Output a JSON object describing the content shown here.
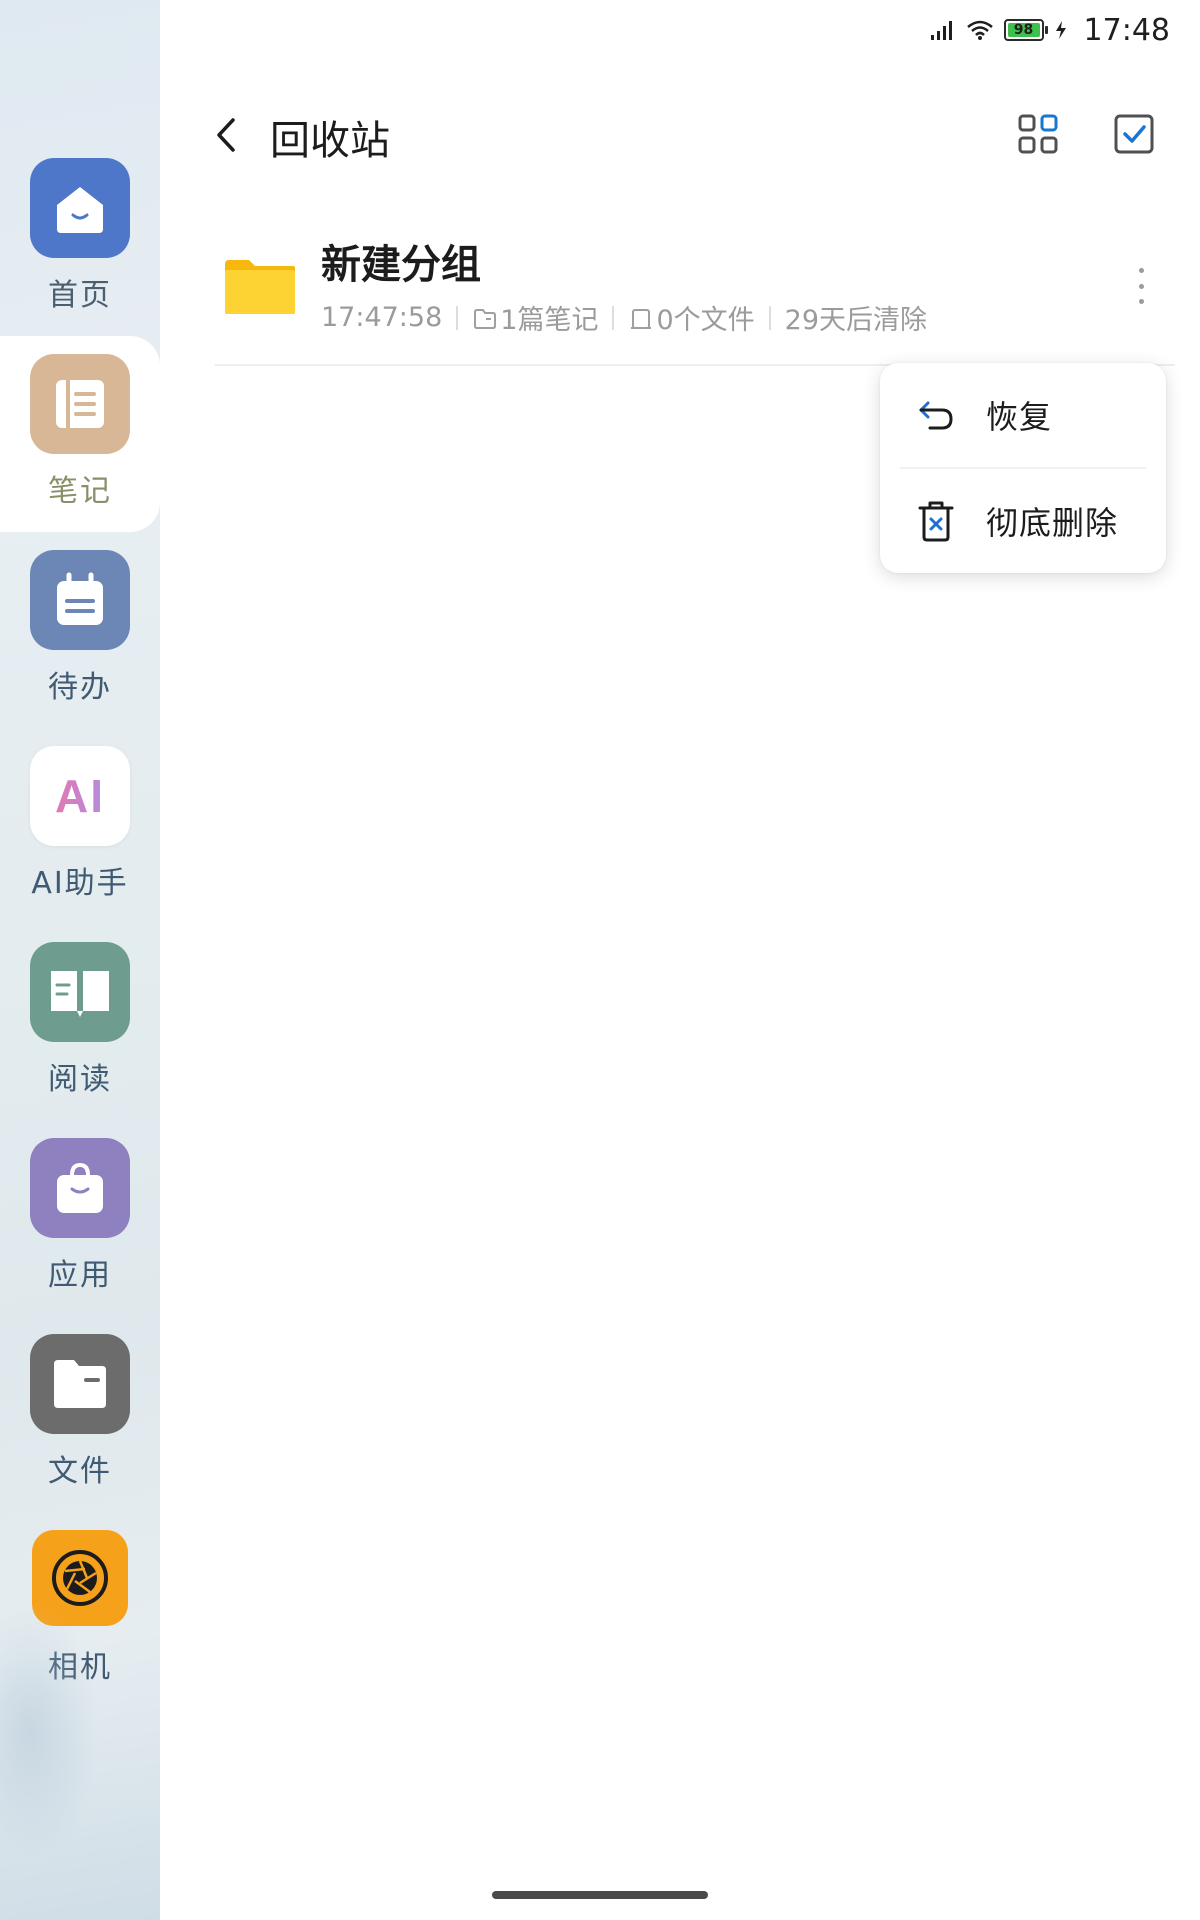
{
  "status_bar": {
    "time": "17:48",
    "battery": "98",
    "icons": [
      "signal-icon",
      "wifi-icon",
      "battery-icon",
      "charging-icon"
    ]
  },
  "sidebar": {
    "items": [
      {
        "label": "首页",
        "icon": "home-icon",
        "active": false
      },
      {
        "label": "笔记",
        "icon": "notebook-icon",
        "active": true
      },
      {
        "label": "待办",
        "icon": "todo-icon",
        "active": false
      },
      {
        "label": "AI助手",
        "icon": "ai-icon",
        "active": false
      },
      {
        "label": "阅读",
        "icon": "book-icon",
        "active": false
      },
      {
        "label": "应用",
        "icon": "bag-icon",
        "active": false
      },
      {
        "label": "文件",
        "icon": "folder-icon",
        "active": false
      },
      {
        "label": "相机",
        "icon": "camera-icon",
        "active": false
      }
    ],
    "ai_logo_text": "AI"
  },
  "header": {
    "title": "回收站"
  },
  "list": [
    {
      "title": "新建分组",
      "time": "17:47:58",
      "notes": "1篇笔记",
      "files": "0个文件",
      "expiry": "29天后清除"
    }
  ],
  "popup_menu": {
    "items": [
      {
        "label": "恢复",
        "icon": "undo-icon"
      },
      {
        "label": "彻底删除",
        "icon": "trash-delete-icon"
      }
    ]
  },
  "colors": {
    "accent": "#1976d2",
    "folder": "#fbc92b",
    "delete_x": "#1f6fd1"
  }
}
